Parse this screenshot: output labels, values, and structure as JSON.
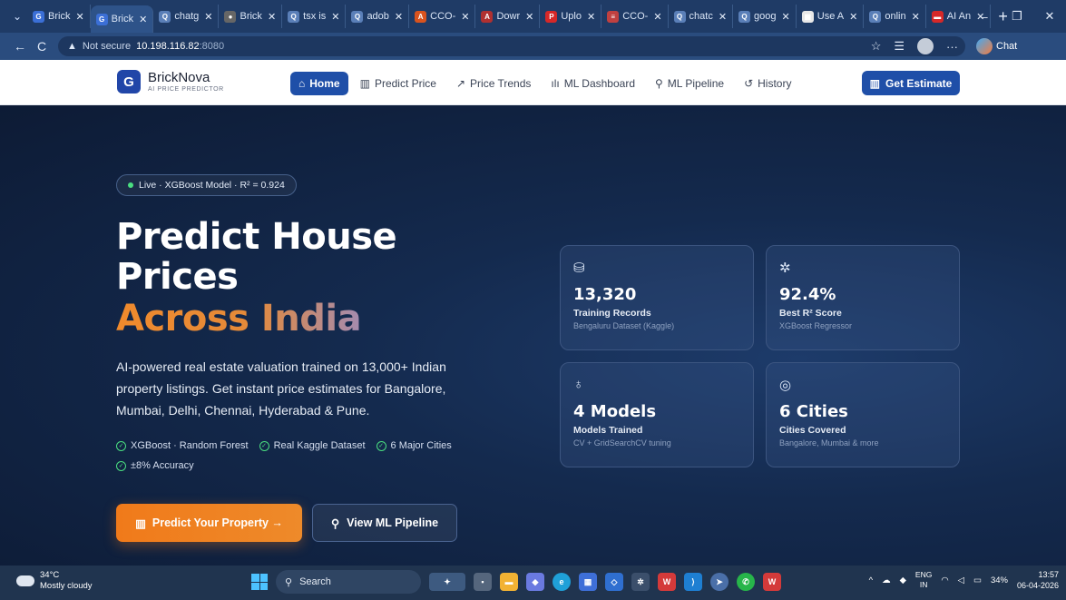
{
  "browser": {
    "tabs": [
      {
        "label": "Brick",
        "fav_color": "#3b6fd6",
        "fav_glyph": "G"
      },
      {
        "label": "Brick",
        "fav_color": "#3b6fd6",
        "fav_glyph": "G",
        "active": true
      },
      {
        "label": "chatg",
        "fav_color": "#5a7fb8",
        "fav_glyph": "Q"
      },
      {
        "label": "Brick",
        "fav_color": "#666666",
        "fav_glyph": "●"
      },
      {
        "label": "tsx is",
        "fav_color": "#5a7fb8",
        "fav_glyph": "Q"
      },
      {
        "label": "adob",
        "fav_color": "#5a7fb8",
        "fav_glyph": "Q"
      },
      {
        "label": "CCO-",
        "fav_color": "#d9531e",
        "fav_glyph": "A"
      },
      {
        "label": "Dowr",
        "fav_color": "#b03030",
        "fav_glyph": "A"
      },
      {
        "label": "Uplo",
        "fav_color": "#d62828",
        "fav_glyph": "P"
      },
      {
        "label": "CCO-",
        "fav_color": "#c04040",
        "fav_glyph": "≡"
      },
      {
        "label": "chatc",
        "fav_color": "#5a7fb8",
        "fav_glyph": "Q"
      },
      {
        "label": "goog",
        "fav_color": "#5a7fb8",
        "fav_glyph": "Q"
      },
      {
        "label": "Use A",
        "fav_color": "#e8e8e8",
        "fav_glyph": "▦"
      },
      {
        "label": "onlin",
        "fav_color": "#5a7fb8",
        "fav_glyph": "Q"
      },
      {
        "label": "AI An",
        "fav_color": "#d62828",
        "fav_glyph": "▬"
      }
    ],
    "url_warning": "Not secure",
    "url_host": "10.198.116.82",
    "url_port": ":8080",
    "copilot_label": "Chat"
  },
  "site": {
    "brand_name": "BrickNova",
    "brand_tagline": "AI PRICE PREDICTOR",
    "brand_logo_letter": "G",
    "nav": [
      {
        "label": "Home",
        "icon": "home-icon",
        "glyph": "⌂",
        "active": true
      },
      {
        "label": "Predict Price",
        "icon": "building-icon",
        "glyph": "▥"
      },
      {
        "label": "Price Trends",
        "icon": "trend-icon",
        "glyph": "↗"
      },
      {
        "label": "ML Dashboard",
        "icon": "bar-chart-icon",
        "glyph": "ılı"
      },
      {
        "label": "ML Pipeline",
        "icon": "pipeline-icon",
        "glyph": "⚲"
      },
      {
        "label": "History",
        "icon": "history-icon",
        "glyph": "↺"
      }
    ],
    "cta_label": "Get Estimate",
    "accent": "#1f4fa8",
    "orange": "#f07a1a"
  },
  "hero": {
    "badge": "Live · XGBoost Model · R² = 0.924",
    "title_line1": "Predict House",
    "title_line2": "Prices",
    "title_line3": "Across India",
    "lead": "AI-powered real estate valuation trained on 13,000+ Indian property listings. Get instant price estimates for Bangalore, Mumbai, Delhi, Chennai, Hyderabad & Pune.",
    "chips": [
      "XGBoost · Random Forest",
      "Real Kaggle Dataset",
      "6 Major Cities",
      "±8% Accuracy"
    ],
    "primary_button": "Predict Your Property →",
    "secondary_button": "View ML Pipeline"
  },
  "stats": [
    {
      "value": "13,320",
      "label": "Training Records",
      "sub": "Bengaluru Dataset (Kaggle)",
      "icon": "database-icon",
      "glyph": "⛁"
    },
    {
      "value": "92.4%",
      "label": "Best R² Score",
      "sub": "XGBoost Regressor",
      "icon": "brain-icon",
      "glyph": "✲"
    },
    {
      "value": "4 Models",
      "label": "Models Trained",
      "sub": "CV + GridSearchCV tuning",
      "icon": "award-icon",
      "glyph": "♁"
    },
    {
      "value": "6 Cities",
      "label": "Cities Covered",
      "sub": "Bangalore, Mumbai & more",
      "icon": "location-pin-icon",
      "glyph": "◎"
    }
  ],
  "taskbar": {
    "temperature": "34°C",
    "weather": "Mostly cloudy",
    "search_placeholder": "Search",
    "lang_top": "ENG",
    "lang_bottom": "IN",
    "battery": "34%",
    "time": "13:57",
    "date": "06-04-2026"
  }
}
